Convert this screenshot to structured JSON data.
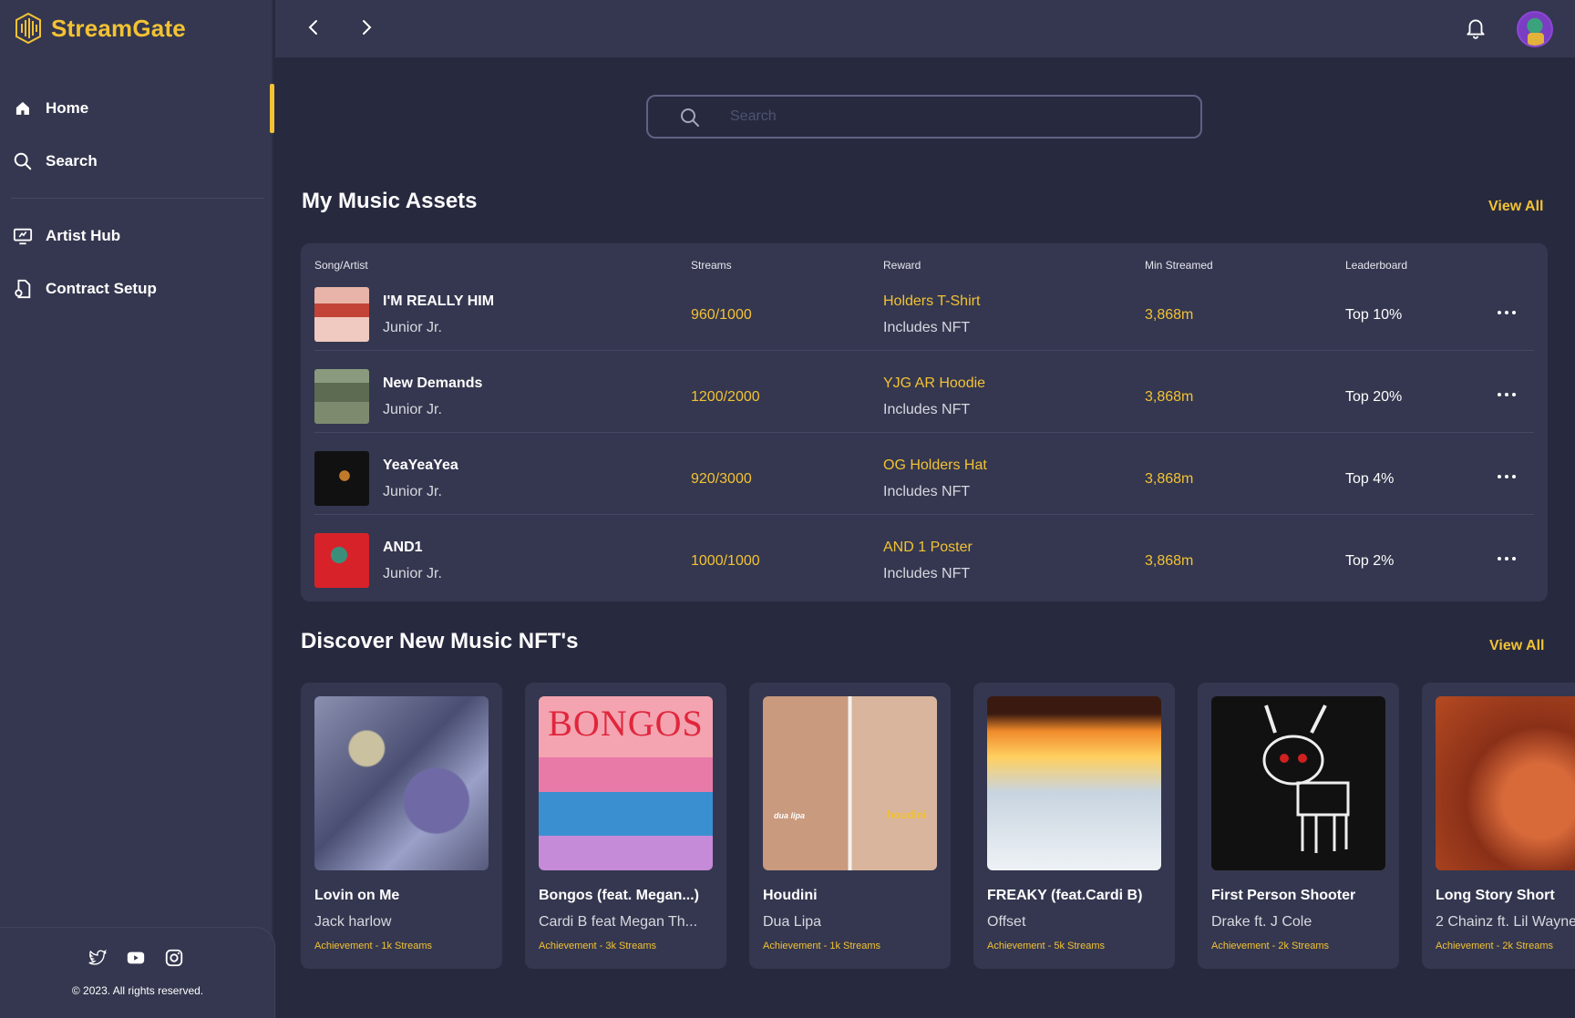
{
  "app": {
    "name": "StreamGate"
  },
  "sidebar": {
    "items": [
      {
        "label": "Home",
        "icon": "home-icon"
      },
      {
        "label": "Search",
        "icon": "search-icon"
      },
      {
        "label": "Artist Hub",
        "icon": "monitor-icon"
      },
      {
        "label": "Contract Setup",
        "icon": "contract-icon"
      }
    ],
    "social": [
      "twitter-icon",
      "youtube-icon",
      "instagram-icon"
    ],
    "copyright": "© 2023. All rights reserved."
  },
  "search": {
    "placeholder": "Search"
  },
  "assets": {
    "title": "My Music Assets",
    "view_all": "View All",
    "columns": [
      "Song/Artist",
      "Streams",
      "Reward",
      "Min Streamed",
      "Leaderboard"
    ],
    "rows": [
      {
        "title": "I'M REALLY HIM",
        "artist": "Junior Jr.",
        "streams": "960/1000",
        "reward": "Holders T-Shirt",
        "reward_sub": "Includes NFT",
        "min_streamed": "3,868m",
        "leaderboard": "Top 10%"
      },
      {
        "title": "New Demands",
        "artist": "Junior Jr.",
        "streams": "1200/2000",
        "reward": "YJG AR Hoodie",
        "reward_sub": "Includes NFT",
        "min_streamed": "3,868m",
        "leaderboard": "Top 20%"
      },
      {
        "title": "YeaYeaYea",
        "artist": "Junior Jr.",
        "streams": "920/3000",
        "reward": "OG Holders Hat",
        "reward_sub": "Includes NFT",
        "min_streamed": "3,868m",
        "leaderboard": "Top 4%"
      },
      {
        "title": "AND1",
        "artist": "Junior Jr.",
        "streams": "1000/1000",
        "reward": "AND 1 Poster",
        "reward_sub": "Includes NFT",
        "min_streamed": "3,868m",
        "leaderboard": "Top 2%"
      }
    ]
  },
  "discover": {
    "title": "Discover New Music NFT's",
    "view_all": "View All",
    "cards": [
      {
        "title": "Lovin on Me",
        "artist": "Jack harlow",
        "achievement": "Achievement - 1k Streams"
      },
      {
        "title": "Bongos (feat. Megan...)",
        "artist": "Cardi B feat Megan Th...",
        "achievement": "Achievement - 3k Streams",
        "art_text": "BONGOS"
      },
      {
        "title": "Houdini",
        "artist": "Dua Lipa",
        "achievement": "Achievement - 1k Streams",
        "art_left": "dua lipa",
        "art_right": "houdini"
      },
      {
        "title": "FREAKY (feat.Cardi B)",
        "artist": "Offset",
        "achievement": "Achievement - 5k Streams"
      },
      {
        "title": "First Person Shooter",
        "artist": "Drake ft. J Cole",
        "achievement": "Achievement - 2k Streams"
      },
      {
        "title": "Long Story Short",
        "artist": "2 Chainz ft. Lil Wayne",
        "achievement": "Achievement - 2k Streams"
      }
    ]
  },
  "colors": {
    "accent": "#f3c234",
    "sidebar": "#34374f",
    "background": "#272a3f"
  }
}
